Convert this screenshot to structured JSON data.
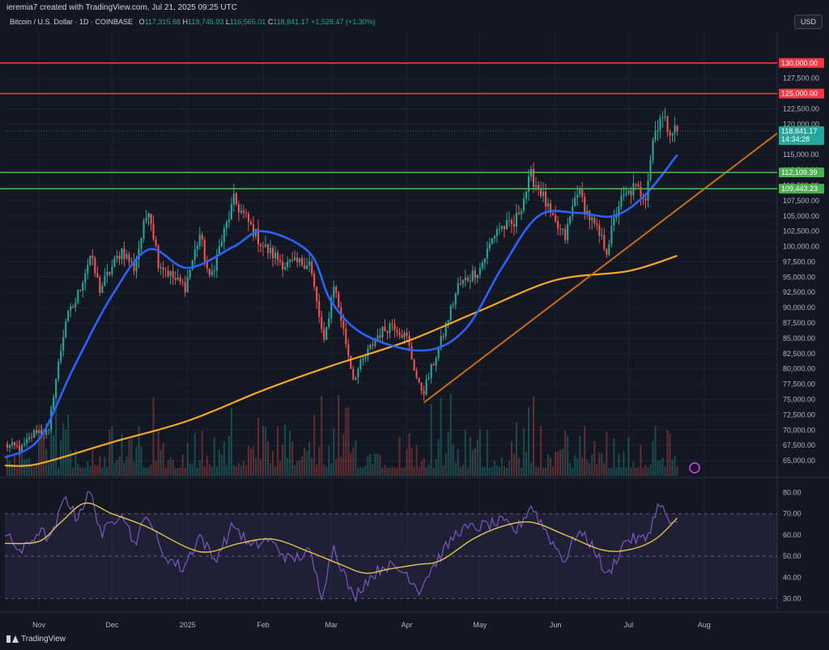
{
  "header": {
    "created_by": "ieremia7 created with TradingView.com, Jul 21, 2025 09:25 UTC",
    "symbol": "Bitcoin / U.S. Dollar · 1D · COINBASE",
    "ohlc": {
      "o_label": "O",
      "o": "117,315.68",
      "h_label": "H",
      "h": "119,745.93",
      "l_label": "L",
      "l": "116,565.01",
      "c_label": "C",
      "c": "118,841.17",
      "change": "+1,528.47 (+1.30%)"
    },
    "currency_button": "USD"
  },
  "footer": {
    "brand": "TradingView"
  },
  "colors": {
    "bg": "#131722",
    "up": "#26a69a",
    "down": "#ef5350",
    "ema_fast": "#2962ff",
    "ema_slow": "#f5a623",
    "trendline": "#c76d18",
    "resistance": "#f23645",
    "support": "#4caf50",
    "rsi": "#7e57c2",
    "rsi_ma": "#e2c54b",
    "grid": "#1e2230",
    "axis_text": "#b2b5be"
  },
  "chart_data": [
    {
      "type": "candlestick",
      "title": "Bitcoin / U.S. Dollar · 1D · COINBASE",
      "ylim": [
        62500,
        135000
      ],
      "y_ticks": [
        65000,
        67500,
        70000,
        72500,
        75000,
        77500,
        80000,
        82500,
        85000,
        87500,
        90000,
        92500,
        95000,
        97500,
        100000,
        102500,
        105000,
        107500,
        110000,
        112500,
        115000,
        117500,
        120000,
        122500,
        127500
      ],
      "y_tick_labels": [
        "65,000.00",
        "67,500.00",
        "70,000.00",
        "72,500.00",
        "75,000.00",
        "77,500.00",
        "80,000.00",
        "82,500.00",
        "85,000.00",
        "87,500.00",
        "90,000.00",
        "92,500.00",
        "95,000.00",
        "97,500.00",
        "100,000.00",
        "102,500.00",
        "105,000.00",
        "107,500.00",
        "110,000.00",
        "112,500.00",
        "115,000.00",
        "117,500.00",
        "120,000.00",
        "122,500.00",
        "127,500.00"
      ],
      "x_range": [
        "2024-10-18",
        "2025-08-31"
      ],
      "x_ticks": [
        "2024-11-01",
        "2024-12-01",
        "2025-01-01",
        "2025-02-01",
        "2025-03-01",
        "2025-04-01",
        "2025-05-01",
        "2025-06-01",
        "2025-07-01",
        "2025-08-01"
      ],
      "x_tick_labels": [
        "Nov",
        "Dec",
        "2025",
        "Feb",
        "Mar",
        "Apr",
        "May",
        "Jun",
        "Jul",
        "Aug"
      ],
      "close_anchors": [
        [
          "2024-10-18",
          67500
        ],
        [
          "2024-10-25",
          67000
        ],
        [
          "2024-10-31",
          70000
        ],
        [
          "2024-11-05",
          69500
        ],
        [
          "2024-11-07",
          76000
        ],
        [
          "2024-11-12",
          88000
        ],
        [
          "2024-11-16",
          91000
        ],
        [
          "2024-11-22",
          98500
        ],
        [
          "2024-11-26",
          93000
        ],
        [
          "2024-12-05",
          99500
        ],
        [
          "2024-12-10",
          96500
        ],
        [
          "2024-12-16",
          106500
        ],
        [
          "2024-12-20",
          97500
        ],
        [
          "2024-12-27",
          94500
        ],
        [
          "2024-12-31",
          93500
        ],
        [
          "2025-01-06",
          102000
        ],
        [
          "2025-01-10",
          94500
        ],
        [
          "2025-01-20",
          107500
        ],
        [
          "2025-01-25",
          104500
        ],
        [
          "2025-02-01",
          100000
        ],
        [
          "2025-02-10",
          97000
        ],
        [
          "2025-02-20",
          97500
        ],
        [
          "2025-02-26",
          84000
        ],
        [
          "2025-03-02",
          94000
        ],
        [
          "2025-03-10",
          78500
        ],
        [
          "2025-03-20",
          85500
        ],
        [
          "2025-03-26",
          87500
        ],
        [
          "2025-04-01",
          85000
        ],
        [
          "2025-04-06",
          77000
        ],
        [
          "2025-04-08",
          76500
        ],
        [
          "2025-04-15",
          84500
        ],
        [
          "2025-04-22",
          93500
        ],
        [
          "2025-05-01",
          96500
        ],
        [
          "2025-05-08",
          103000
        ],
        [
          "2025-05-15",
          103500
        ],
        [
          "2025-05-22",
          111500
        ],
        [
          "2025-05-26",
          109000
        ],
        [
          "2025-05-31",
          104000
        ],
        [
          "2025-06-05",
          101500
        ],
        [
          "2025-06-10",
          109500
        ],
        [
          "2025-06-14",
          105500
        ],
        [
          "2025-06-22",
          99500
        ],
        [
          "2025-06-27",
          107000
        ],
        [
          "2025-07-03",
          109500
        ],
        [
          "2025-07-08",
          108500
        ],
        [
          "2025-07-11",
          117500
        ],
        [
          "2025-07-14",
          121500
        ],
        [
          "2025-07-17",
          119500
        ],
        [
          "2025-07-21",
          118841
        ]
      ],
      "series": [
        {
          "name": "EMA fast",
          "values": [
            [
              "2024-10-18",
              65500
            ],
            [
              "2024-11-01",
              68500
            ],
            [
              "2024-11-15",
              80000
            ],
            [
              "2024-12-01",
              92000
            ],
            [
              "2024-12-16",
              99500
            ],
            [
              "2025-01-01",
              96500
            ],
            [
              "2025-01-20",
              100000
            ],
            [
              "2025-02-01",
              102500
            ],
            [
              "2025-02-20",
              99000
            ],
            [
              "2025-03-01",
              91000
            ],
            [
              "2025-03-15",
              85500
            ],
            [
              "2025-04-08",
              83000
            ],
            [
              "2025-04-25",
              86500
            ],
            [
              "2025-05-10",
              96500
            ],
            [
              "2025-05-25",
              105000
            ],
            [
              "2025-06-10",
              105500
            ],
            [
              "2025-06-25",
              105000
            ],
            [
              "2025-07-08",
              108500
            ],
            [
              "2025-07-21",
              115000
            ]
          ]
        },
        {
          "name": "EMA slow",
          "values": [
            [
              "2024-10-18",
              64200
            ],
            [
              "2024-11-01",
              64500
            ],
            [
              "2024-12-01",
              68000
            ],
            [
              "2025-01-01",
              71500
            ],
            [
              "2025-02-01",
              76500
            ],
            [
              "2025-03-01",
              80500
            ],
            [
              "2025-04-01",
              84500
            ],
            [
              "2025-05-01",
              89500
            ],
            [
              "2025-06-01",
              94500
            ],
            [
              "2025-07-01",
              96000
            ],
            [
              "2025-07-21",
              98500
            ]
          ]
        }
      ],
      "trendline": [
        [
          "2025-04-08",
          74500
        ],
        [
          "2025-08-31",
          118500
        ]
      ],
      "levels": [
        {
          "value": 130000,
          "label": "130,000.00",
          "kind": "resistance"
        },
        {
          "value": 125000,
          "label": "125,000.00",
          "kind": "resistance"
        },
        {
          "value": 112109.39,
          "label": "112,109.39",
          "kind": "support"
        },
        {
          "value": 109443.23,
          "label": "109,443.23",
          "kind": "support"
        }
      ],
      "last_price": {
        "value": 118841.17,
        "label": "118,841.17",
        "countdown": "14:34:28"
      }
    },
    {
      "type": "line",
      "ylim": [
        26,
        84
      ],
      "y_ticks": [
        30,
        40,
        50,
        60,
        70,
        80
      ],
      "y_tick_labels": [
        "30.00",
        "40.00",
        "50.00",
        "60.00",
        "70.00",
        "80.00"
      ],
      "bands": {
        "upper": 70,
        "middle": 50,
        "lower": 30
      },
      "series": [
        {
          "name": "RSI",
          "values": [
            [
              "2024-10-18",
              60
            ],
            [
              "2024-10-25",
              52
            ],
            [
              "2024-11-01",
              62
            ],
            [
              "2024-11-06",
              58
            ],
            [
              "2024-11-12",
              79
            ],
            [
              "2024-11-16",
              68
            ],
            [
              "2024-11-22",
              80
            ],
            [
              "2024-11-27",
              60
            ],
            [
              "2024-12-05",
              72
            ],
            [
              "2024-12-10",
              56
            ],
            [
              "2024-12-16",
              70
            ],
            [
              "2024-12-21",
              52
            ],
            [
              "2024-12-30",
              44
            ],
            [
              "2025-01-06",
              60
            ],
            [
              "2025-01-12",
              48
            ],
            [
              "2025-01-20",
              65
            ],
            [
              "2025-01-27",
              54
            ],
            [
              "2025-02-03",
              58
            ],
            [
              "2025-02-12",
              48
            ],
            [
              "2025-02-20",
              52
            ],
            [
              "2025-02-25",
              32
            ],
            [
              "2025-03-02",
              55
            ],
            [
              "2025-03-10",
              30
            ],
            [
              "2025-03-15",
              38
            ],
            [
              "2025-03-23",
              46
            ],
            [
              "2025-04-01",
              42
            ],
            [
              "2025-04-06",
              34
            ],
            [
              "2025-04-11",
              44
            ],
            [
              "2025-04-22",
              62
            ],
            [
              "2025-05-01",
              64
            ],
            [
              "2025-05-10",
              66
            ],
            [
              "2025-05-16",
              62
            ],
            [
              "2025-05-22",
              74
            ],
            [
              "2025-05-31",
              56
            ],
            [
              "2025-06-05",
              48
            ],
            [
              "2025-06-10",
              62
            ],
            [
              "2025-06-17",
              54
            ],
            [
              "2025-06-22",
              40
            ],
            [
              "2025-06-30",
              58
            ],
            [
              "2025-07-08",
              58
            ],
            [
              "2025-07-14",
              76
            ],
            [
              "2025-07-17",
              66
            ],
            [
              "2025-07-21",
              66
            ]
          ]
        },
        {
          "name": "RSI MA",
          "values": [
            [
              "2024-10-18",
              56
            ],
            [
              "2024-11-01",
              57
            ],
            [
              "2024-11-10",
              66
            ],
            [
              "2024-11-20",
              75
            ],
            [
              "2024-12-01",
              70
            ],
            [
              "2024-12-15",
              64
            ],
            [
              "2025-01-01",
              54
            ],
            [
              "2025-01-10",
              52
            ],
            [
              "2025-01-22",
              56
            ],
            [
              "2025-02-05",
              58
            ],
            [
              "2025-02-20",
              52
            ],
            [
              "2025-03-05",
              46
            ],
            [
              "2025-03-15",
              42
            ],
            [
              "2025-03-25",
              44
            ],
            [
              "2025-04-05",
              46
            ],
            [
              "2025-04-15",
              48
            ],
            [
              "2025-04-28",
              58
            ],
            [
              "2025-05-10",
              64
            ],
            [
              "2025-05-22",
              66
            ],
            [
              "2025-06-05",
              60
            ],
            [
              "2025-06-20",
              53
            ],
            [
              "2025-07-01",
              53
            ],
            [
              "2025-07-12",
              58
            ],
            [
              "2025-07-21",
              68
            ]
          ]
        }
      ]
    }
  ]
}
